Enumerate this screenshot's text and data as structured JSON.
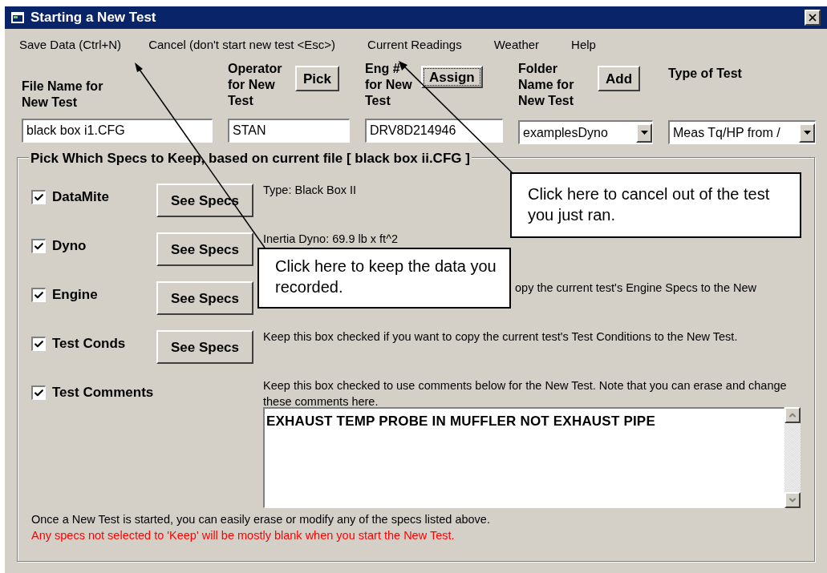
{
  "window": {
    "title": "Starting a New Test"
  },
  "menu": [
    {
      "label": "Save Data (Ctrl+N)"
    },
    {
      "label": "Cancel (don't start new test <Esc>)"
    },
    {
      "label": "Current Readings"
    },
    {
      "label": "Weather"
    },
    {
      "label": "Help"
    }
  ],
  "fields": [
    {
      "kind": "text",
      "label": "File Name for New Test",
      "value": "black box i1.CFG"
    },
    {
      "kind": "text",
      "label": "Operator for New Test",
      "button": "Pick",
      "value": "STAN"
    },
    {
      "kind": "text",
      "label": "Eng # for New Test",
      "button": "Assign",
      "button_focused": true,
      "value": "DRV8D214946"
    },
    {
      "kind": "dropdown",
      "label": "Folder Name for New Test",
      "button": "Add",
      "value": "examplesDyno"
    },
    {
      "kind": "dropdown",
      "label": "Type of Test",
      "value": "Meas Tq/HP from /"
    }
  ],
  "specs": {
    "title": "Pick Which Specs to Keep, based on current file [ black box ii.CFG ]",
    "rows": [
      {
        "label": "DataMite",
        "checked": true,
        "button": "See Specs",
        "description": "Type: Black Box II"
      },
      {
        "label": "Dyno",
        "checked": true,
        "button": "See Specs",
        "description": "Inertia Dyno:  69.9 lb x ft^2"
      },
      {
        "label": "Engine",
        "checked": true,
        "button": "See Specs",
        "description": "opy the current test's Engine Specs to the New",
        "covered": true
      },
      {
        "label": "Test Conds",
        "checked": true,
        "button": "See Specs",
        "description": "Keep this box checked if you want to copy the current test's Test Conditions to the New Test."
      },
      {
        "label": "Test Comments",
        "checked": true,
        "description": "Keep this box checked to use comments below for the New Test.  Note that you can erase and change these comments here."
      }
    ],
    "comments": "EXHAUST TEMP PROBE IN MUFFLER NOT EXHAUST PIPE",
    "notes": [
      {
        "kind": "info",
        "text": "Once a New Test is started, you can easily erase or modify any of the specs listed above."
      },
      {
        "kind": "warning",
        "text": "Any specs not selected to 'Keep' will be mostly blank when you start the New Test."
      }
    ]
  },
  "callouts": [
    {
      "kind": "keep",
      "text": "Click here to keep the data you recorded."
    },
    {
      "kind": "cancel",
      "text": "Click here to cancel out of the test you just ran."
    }
  ]
}
